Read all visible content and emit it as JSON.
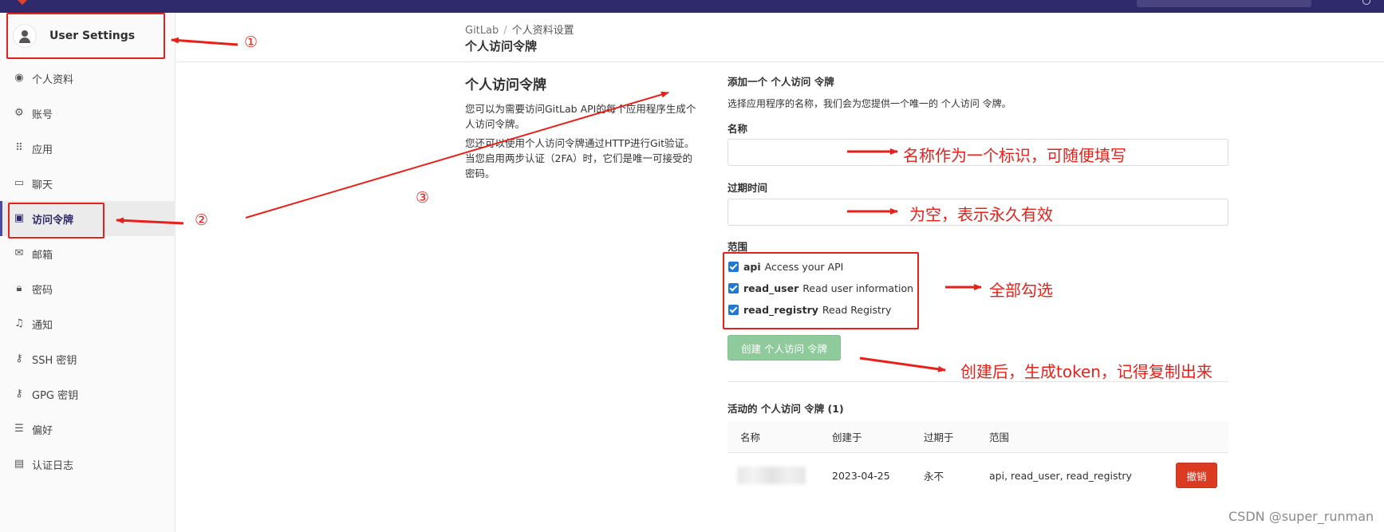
{
  "sidebar": {
    "context_title": "User Settings",
    "items": [
      {
        "label": "个人资料",
        "icon": "profile-icon"
      },
      {
        "label": "账号",
        "icon": "account-gear-icon"
      },
      {
        "label": "应用",
        "icon": "applications-grid-icon"
      },
      {
        "label": "聊天",
        "icon": "chat-icon"
      },
      {
        "label": "访问令牌",
        "icon": "token-icon",
        "active": true
      },
      {
        "label": "邮箱",
        "icon": "mail-icon"
      },
      {
        "label": "密码",
        "icon": "lock-icon"
      },
      {
        "label": "通知",
        "icon": "bell-icon"
      },
      {
        "label": "SSH 密钥",
        "icon": "key-icon"
      },
      {
        "label": "GPG 密钥",
        "icon": "key-icon"
      },
      {
        "label": "偏好",
        "icon": "sliders-icon"
      },
      {
        "label": "认证日志",
        "icon": "log-icon"
      }
    ]
  },
  "breadcrumb": {
    "root": "GitLab",
    "separator": "/",
    "current": "个人资料设置"
  },
  "page_title": "个人访问令牌",
  "description": {
    "title": "个人访问令牌",
    "p1": "您可以为需要访问GitLab API的每个应用程序生成个人访问令牌。",
    "p2": "您还可以使用个人访问令牌通过HTTP进行Git验证。 当您启用两步认证（2FA）时，它们是唯一可接受的密码。"
  },
  "form": {
    "heading": "添加一个 个人访问 令牌",
    "subheading": "选择应用程序的名称，我们会为您提供一个唯一的 个人访问 令牌。",
    "name_label": "名称",
    "name_value": "",
    "expiry_label": "过期时间",
    "expiry_value": "",
    "scopes_label": "范围",
    "scopes": [
      {
        "name": "api",
        "desc": "Access your API",
        "checked": true
      },
      {
        "name": "read_user",
        "desc": "Read user information",
        "checked": true
      },
      {
        "name": "read_registry",
        "desc": "Read Registry",
        "checked": true
      }
    ],
    "create_button": "创建 个人访问 令牌"
  },
  "active_tokens": {
    "title": "活动的 个人访问 令牌 (1)",
    "columns": [
      "名称",
      "创建于",
      "过期于",
      "范围"
    ],
    "rows": [
      {
        "name": "",
        "created": "2023-04-25",
        "expires": "永不",
        "scopes": "api, read_user, read_registry",
        "action": "撤销"
      }
    ]
  },
  "annotations": {
    "circle1": "①",
    "circle2": "②",
    "circle3": "③",
    "note_name": "名称作为一个标识，可随便填写",
    "note_expiry": "为空，表示永久有效",
    "note_scopes": "全部勾选",
    "note_create": "创建后，生成token，记得复制出来",
    "color": "#e8201a"
  },
  "watermark": "CSDN @super_runman",
  "colors": {
    "topbar": "#2f2a6b",
    "create_button": "#8fca9c",
    "revoke_button": "#db3b21",
    "checkbox": "#1f78d1"
  }
}
